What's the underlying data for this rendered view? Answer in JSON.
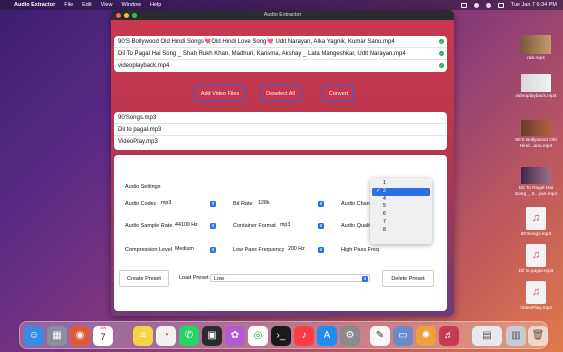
{
  "menubar": {
    "apple": "",
    "app_name": "Audio Extractor",
    "items": [
      "File",
      "Edit",
      "View",
      "Window",
      "Help"
    ],
    "clock": "Tue Jan 7  6:34 PM"
  },
  "window": {
    "title": "Audio Extractor",
    "video_files": [
      "90'S Bollywood Old Hindi Songs💘Old Hindi Love Song💘 Udit Narayan, Alka Yagnik, Kumar Sanu.mp4",
      "Dil To Pagal Hai Song _ Shah Rukh Khan, Madhuri, Karisma, Akshay _ Lata Mangeshkar, Udit Narayan.mp4",
      "videoplayback.mp4"
    ],
    "check_glyph": "✓",
    "buttons": {
      "add": "Add Video Files",
      "deselect": "Deselect All",
      "convert": "Convert"
    },
    "audio_files": [
      "90'Songs.mp3",
      "Dil to pagal.mp3",
      "VideoPlay.mp3"
    ],
    "settings": {
      "heading": "Audio Settings",
      "codec_label": "Audio Codec",
      "codec_value": "mp3",
      "bitrate_label": "Bit Rate",
      "bitrate_value": "128k",
      "channel_label": "Audio Channel",
      "sample_label": "Audio Sample Rate",
      "sample_value": "44100 Hz",
      "container_label": "Container Format",
      "container_value": "mp3",
      "quality_label": "Audio Quality",
      "compression_label": "Compression Level",
      "compression_value": "Medium",
      "lowpass_label": "Low Pass Frequency",
      "lowpass_value": "200 Hz",
      "highpass_label": "High Pass Freq",
      "create_preset": "Create Preset",
      "load_preset_label": "Load Preset",
      "load_preset_value": "Low",
      "delete_preset": "Delete Preset"
    },
    "channel_popup": {
      "options": [
        "1",
        "2",
        "4",
        "5",
        "6",
        "7",
        "8"
      ],
      "selected": "2"
    }
  },
  "desktop": {
    "items": [
      "rab.mp4",
      "videoplayback.mp4",
      "90'S Bollywood Old Hind...anu.mp4",
      "Dil To Pagal Hai Song _ S...yan.mp4",
      "90'Songs.mp3",
      "Dil to pagal.mp3",
      "VideoPlay.mp3"
    ]
  },
  "dock": {
    "calendar_month": "JAN",
    "calendar_day": "7",
    "apps": [
      "finder-icon",
      "launchpad-icon",
      "calendar-icon",
      "notes-icon",
      "chrome-dev-icon",
      "whatsapp-icon",
      "photo-icon",
      "mindmap-icon",
      "chrome-icon",
      "terminal-icon",
      "music-icon",
      "appstore-icon",
      "settings-icon",
      "textedit-icon",
      "preview-icon",
      "photos-icon",
      "audio-extractor-icon",
      "downloads-icon",
      "trash-icon"
    ]
  }
}
